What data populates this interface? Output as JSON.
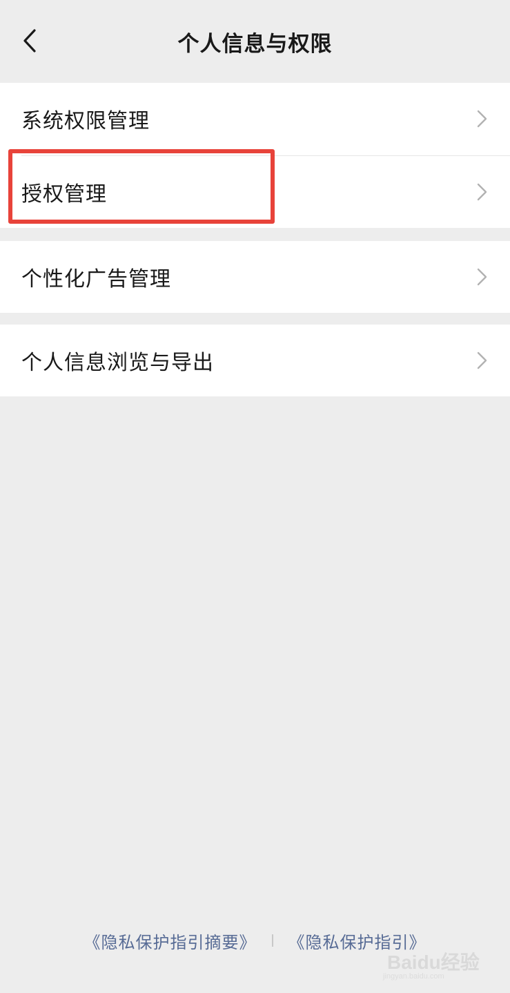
{
  "nav": {
    "title": "个人信息与权限",
    "back_icon": "chevron-left-icon"
  },
  "groups": [
    {
      "items": [
        {
          "label": "系统权限管理",
          "icon": "chevron-right-icon"
        },
        {
          "label": "授权管理",
          "icon": "chevron-right-icon",
          "highlighted": true
        }
      ]
    },
    {
      "items": [
        {
          "label": "个性化广告管理",
          "icon": "chevron-right-icon"
        }
      ]
    },
    {
      "items": [
        {
          "label": "个人信息浏览与导出",
          "icon": "chevron-right-icon"
        }
      ]
    }
  ],
  "footer": {
    "link_summary": "《隐私保护指引摘要》",
    "link_full": "《隐私保护指引》"
  },
  "watermark": {
    "brand": "Baidu经验",
    "url": "jingyan.baidu.com"
  },
  "colors": {
    "background": "#ededed",
    "cell": "#ffffff",
    "text": "#191919",
    "link": "#576b95",
    "highlight": "#e8433a",
    "chevron": "#b2b2b2"
  }
}
